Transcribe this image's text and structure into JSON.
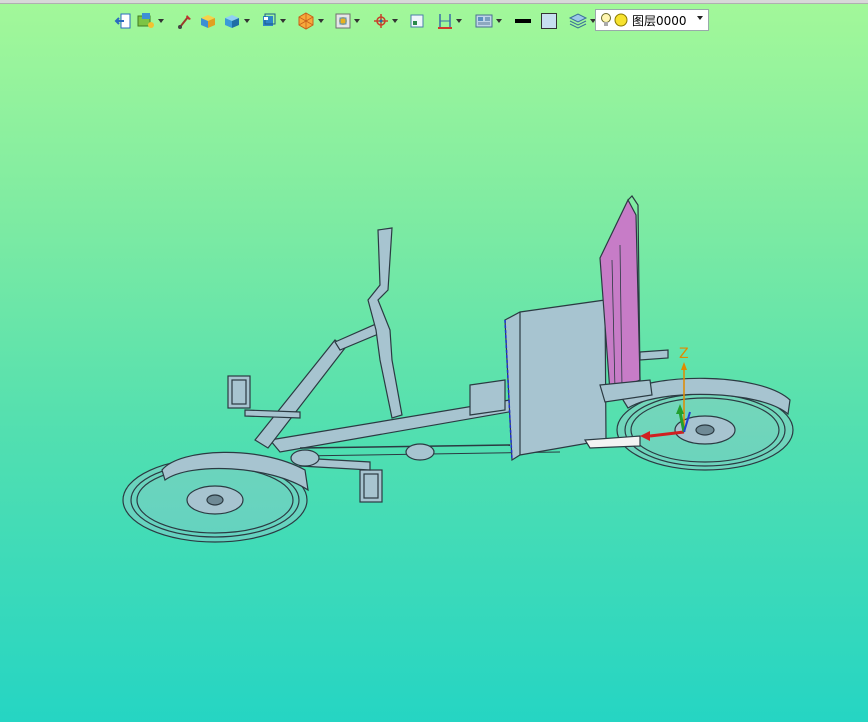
{
  "toolbar": {
    "buttons": [
      {
        "name": "exit-icon",
        "caret": false
      },
      {
        "name": "layers-icon",
        "caret": true
      },
      {
        "name": "brush-icon",
        "caret": false
      },
      {
        "name": "yellow-cube-icon",
        "caret": false
      },
      {
        "name": "blue-cube-icon",
        "caret": true
      },
      {
        "name": "view-cube-icon",
        "caret": true
      },
      {
        "name": "render-sphere-icon",
        "caret": true
      },
      {
        "name": "frame-icon",
        "caret": true
      },
      {
        "name": "crosshair-icon",
        "caret": true
      },
      {
        "name": "select-box-icon",
        "caret": false
      },
      {
        "name": "dimension-icon",
        "caret": true
      },
      {
        "name": "display-mode-icon",
        "caret": true
      },
      {
        "name": "line-color-icon",
        "caret": false
      },
      {
        "name": "fill-color-icon",
        "caret": false
      },
      {
        "name": "layer-stack-icon",
        "caret": true
      }
    ]
  },
  "layer_selector": {
    "value": "图层0000",
    "icons": [
      "lightbulb-icon",
      "layer-color-dot-icon"
    ]
  },
  "axis": {
    "z_label": "Z"
  },
  "colors": {
    "bg_top": "#a3f899",
    "bg_bottom": "#25d5c3",
    "model_body": "#a7c4d0",
    "seat_back": "#c77cc7",
    "axis_z": "#e08a00"
  }
}
